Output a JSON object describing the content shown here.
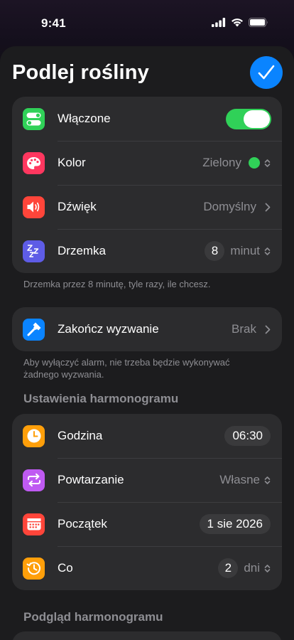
{
  "status": {
    "time": "9:41"
  },
  "header": {
    "title": "Podlej rośliny"
  },
  "general": {
    "enabled_label": "Włączone",
    "color_label": "Kolor",
    "color_value": "Zielony",
    "color_hex": "#30d158",
    "sound_label": "Dźwięk",
    "sound_value": "Domyślny",
    "snooze_label": "Drzemka",
    "snooze_value": "8",
    "snooze_unit": "minut",
    "footnote": "Drzemka przez 8 minutę, tyle razy, ile chcesz."
  },
  "challenge": {
    "label": "Zakończ wyzwanie",
    "value": "Brak",
    "footnote": "Aby wyłączyć alarm, nie trzeba będzie wykonywać żadnego wyzwania."
  },
  "schedule": {
    "section_title": "Ustawienia harmonogramu",
    "time_label": "Godzina",
    "time_value": "06:30",
    "repeat_label": "Powtarzanie",
    "repeat_value": "Własne",
    "start_label": "Początek",
    "start_value": "1 sie 2026",
    "every_label": "Co",
    "every_value": "2",
    "every_unit": "dni"
  },
  "preview": {
    "section_title": "Podgląd harmonogramu"
  },
  "icons": {
    "toggle": "toggle-icon",
    "palette": "palette-icon",
    "speaker": "speaker-icon",
    "snooze": "zzz-icon",
    "hammer": "hammer-icon",
    "clock": "clock-icon",
    "repeat": "repeat-icon",
    "calendar": "calendar-icon",
    "history": "history-icon"
  }
}
